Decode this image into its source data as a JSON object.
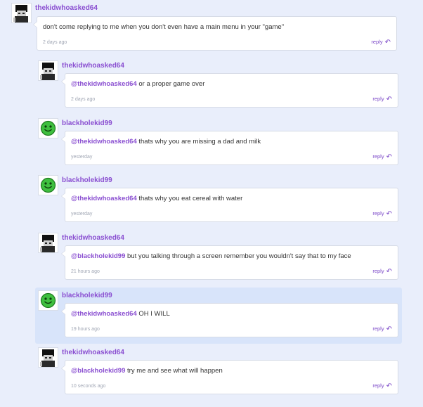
{
  "comments": [
    {
      "username": "thekidwhoasked64",
      "avatar": "blocky-black-hair-avatar",
      "mention": "",
      "text": "don't come replying to me when you don't even have a main menu in your \"game\"",
      "time": "2 days ago",
      "reply_label": "reply"
    },
    {
      "username": "thekidwhoasked64",
      "avatar": "blocky-black-hair-avatar",
      "mention": "@thekidwhoasked64",
      "text": " or a proper game over",
      "time": "2 days ago",
      "reply_label": "reply"
    },
    {
      "username": "blackholekid99",
      "avatar": "green-smiley-avatar",
      "mention": "@thekidwhoasked64",
      "text": " thats why you are missing a dad and milk",
      "time": "yesterday",
      "reply_label": "reply"
    },
    {
      "username": "blackholekid99",
      "avatar": "green-smiley-avatar",
      "mention": "@thekidwhoasked64",
      "text": " thats why you eat cereal with water",
      "time": "yesterday",
      "reply_label": "reply"
    },
    {
      "username": "thekidwhoasked64",
      "avatar": "blocky-black-hair-avatar",
      "mention": "@blackholekid99",
      "text": " but you talking through a screen remember you wouldn't say that to my face",
      "time": "21 hours ago",
      "reply_label": "reply"
    },
    {
      "username": "blackholekid99",
      "avatar": "green-smiley-avatar",
      "mention": "@thekidwhoasked64",
      "text": " OH I WILL",
      "time": "19 hours ago",
      "reply_label": "reply",
      "highlighted": true
    },
    {
      "username": "thekidwhoasked64",
      "avatar": "blocky-black-hair-avatar",
      "mention": "@blackholekid99",
      "text": " try me and see what will happen",
      "time": "10 seconds ago",
      "reply_label": "reply"
    }
  ],
  "colors": {
    "background": "#e9eefb",
    "highlight": "#d8e4fa",
    "username": "#8a4fd1",
    "reply": "#7b48c8",
    "smiley_green": "#3fbf3f"
  }
}
